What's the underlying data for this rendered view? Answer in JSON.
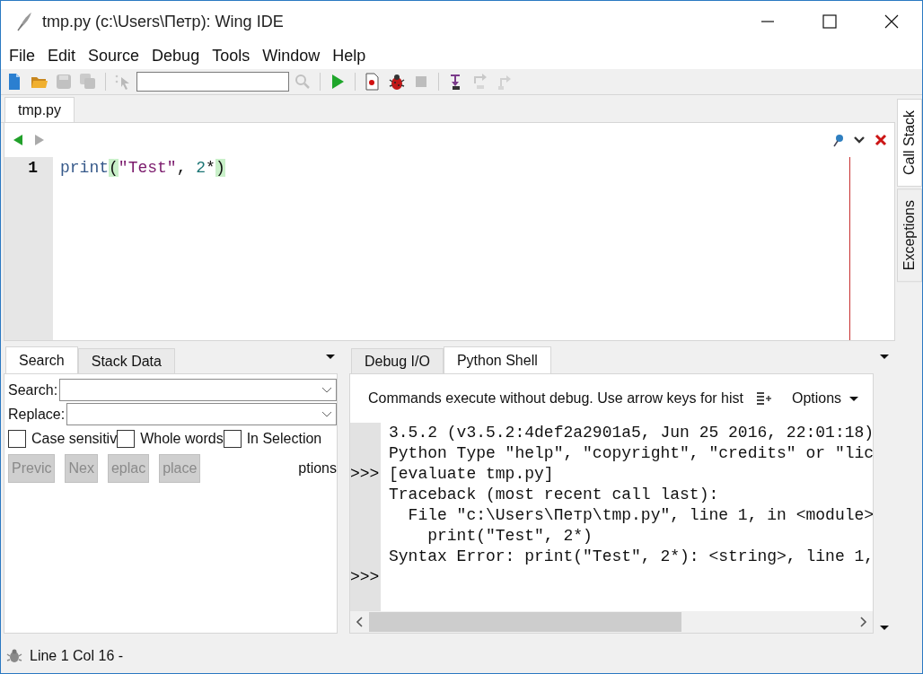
{
  "window": {
    "title": "tmp.py (c:\\Users\\Петр): Wing IDE"
  },
  "menu": [
    "File",
    "Edit",
    "Source",
    "Debug",
    "Tools",
    "Window",
    "Help"
  ],
  "toolbar": [
    {
      "kind": "new",
      "disabled": false
    },
    {
      "kind": "open",
      "disabled": false
    },
    {
      "kind": "save",
      "disabled": true
    },
    {
      "kind": "save-all",
      "disabled": true
    },
    {
      "kind": "separator"
    },
    {
      "kind": "pointer",
      "disabled": true
    },
    {
      "kind": "search-field"
    },
    {
      "kind": "search",
      "disabled": true
    },
    {
      "kind": "separator"
    },
    {
      "kind": "run",
      "disabled": false
    },
    {
      "kind": "separator"
    },
    {
      "kind": "breakpoint",
      "disabled": false
    },
    {
      "kind": "debug",
      "disabled": false
    },
    {
      "kind": "stop",
      "disabled": true
    },
    {
      "kind": "separator"
    },
    {
      "kind": "step-into",
      "disabled": false
    },
    {
      "kind": "step-over",
      "disabled": true
    },
    {
      "kind": "step-out",
      "disabled": true
    }
  ],
  "editor": {
    "tabs": [
      {
        "label": "tmp.py",
        "selected": true
      }
    ],
    "lines": [
      {
        "number": "1",
        "tokens": [
          {
            "kind": "keyword",
            "text": "print"
          },
          {
            "kind": "brace",
            "text": "("
          },
          {
            "kind": "string",
            "text": "\"Test\""
          },
          {
            "kind": "plain",
            "text": ", "
          },
          {
            "kind": "number",
            "text": "2"
          },
          {
            "kind": "plain",
            "text": "*"
          },
          {
            "kind": "brace",
            "text": ")"
          }
        ]
      }
    ]
  },
  "side_tabs": [
    {
      "label": "Call Stack",
      "selected": true
    },
    {
      "label": "Exceptions",
      "selected": false
    }
  ],
  "search_panel": {
    "tabs": [
      {
        "label": "Search",
        "selected": true
      },
      {
        "label": "Stack Data",
        "selected": false
      }
    ],
    "fields": [
      {
        "label": "Search:"
      },
      {
        "label": "Replace:"
      }
    ],
    "options": [
      {
        "label": "Case sensitiv",
        "checked": false
      },
      {
        "label": "Whole words",
        "checked": false
      },
      {
        "label": "In Selection",
        "checked": false
      }
    ],
    "buttons": [
      {
        "label": "Previc",
        "disabled": true
      },
      {
        "label": "Nex",
        "disabled": true
      },
      {
        "label": "eplac",
        "disabled": true
      },
      {
        "label": "place",
        "disabled": true
      }
    ],
    "options_label": "ptions"
  },
  "shell_panel": {
    "tabs": [
      {
        "label": "Debug I/O",
        "selected": false
      },
      {
        "label": "Python Shell",
        "selected": true
      }
    ],
    "hint": "Commands execute without debug.  Use arrow keys for hist",
    "options_label": "Options",
    "lines": [
      {
        "text": "3.5.2 (v3.5.2:4def2a2901a5, Jun 25 2016, 22:01:18)"
      },
      {
        "text": "Python Type \"help\", \"copyright\", \"credits\" or \"lic"
      },
      {
        "prompt": ">>>",
        "text": "[evaluate tmp.py]"
      },
      {
        "text": "Traceback (most recent call last):"
      },
      {
        "text": "  File \"c:\\Users\\Петр\\tmp.py\", line 1, in <module>"
      },
      {
        "text": "    print(\"Test\", 2*)"
      },
      {
        "text": "Syntax Error: print(\"Test\", 2*): <string>, line 1,"
      },
      {
        "prompt": ">>>"
      }
    ]
  },
  "status_bar": {
    "text": "Line 1 Col 16 -"
  }
}
